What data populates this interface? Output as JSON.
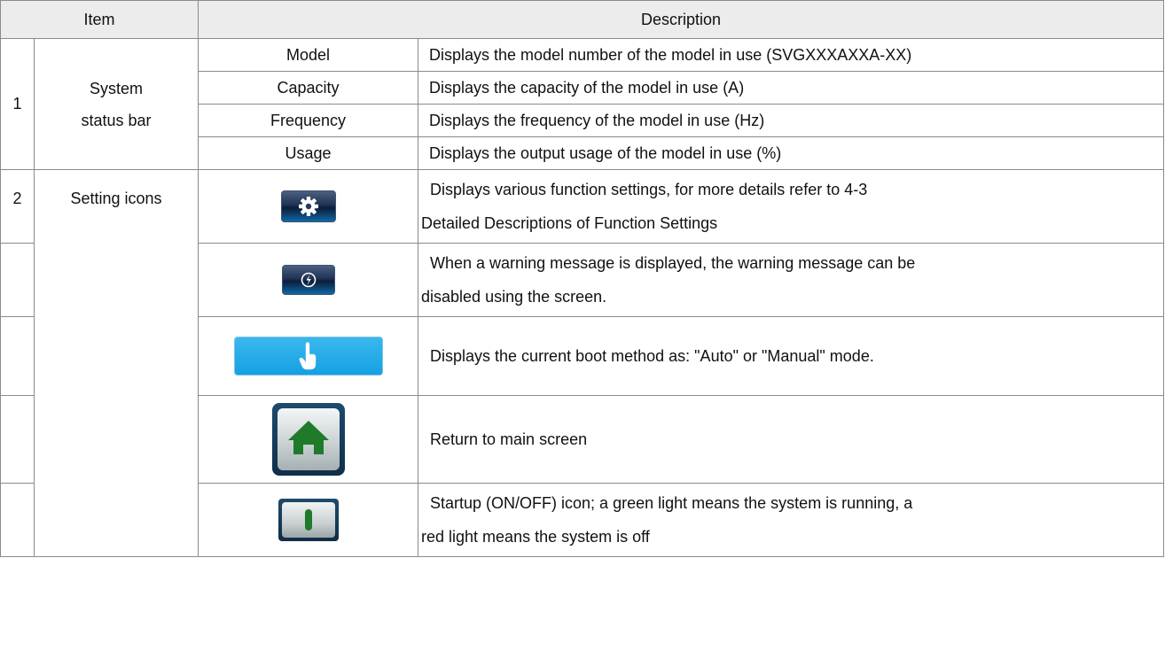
{
  "headers": {
    "item": "Item",
    "description": "Description"
  },
  "section1": {
    "number": "1",
    "label_line1": "System",
    "label_line2": "status bar",
    "rows": [
      {
        "name": "Model",
        "description": "Displays the model number of the model in use (SVGXXXAXXA-XX)"
      },
      {
        "name": "Capacity",
        "description": "Displays the capacity of the model in use (A)"
      },
      {
        "name": "Frequency",
        "description": "Displays the frequency of the model in use (Hz)"
      },
      {
        "name": "Usage",
        "description": "Displays the output usage of the model in use (%)"
      }
    ]
  },
  "section2": {
    "number": "2",
    "label": "Setting icons",
    "rows": [
      {
        "icon": "gear-icon",
        "line1": "Displays various function settings, for more details refer to 4-3",
        "line2": "Detailed Descriptions of Function Settings"
      },
      {
        "icon": "warning-mute-icon",
        "line1": "When a warning message is displayed, the warning message can be",
        "line2": "disabled using the screen."
      },
      {
        "icon": "hand-pointer-icon",
        "line1": "Displays the current boot method as: \"Auto\" or \"Manual\" mode."
      },
      {
        "icon": "home-icon",
        "line1": "Return to main screen"
      },
      {
        "icon": "power-icon",
        "line1": "Startup (ON/OFF) icon; a green light means the system is running, a",
        "line2": "red light means the system is off"
      }
    ]
  },
  "colors": {
    "header_bg": "#ececec",
    "border": "#8a8a8a",
    "blue_button": "#1aa3e6",
    "green_icon": "#1f7a2a"
  }
}
